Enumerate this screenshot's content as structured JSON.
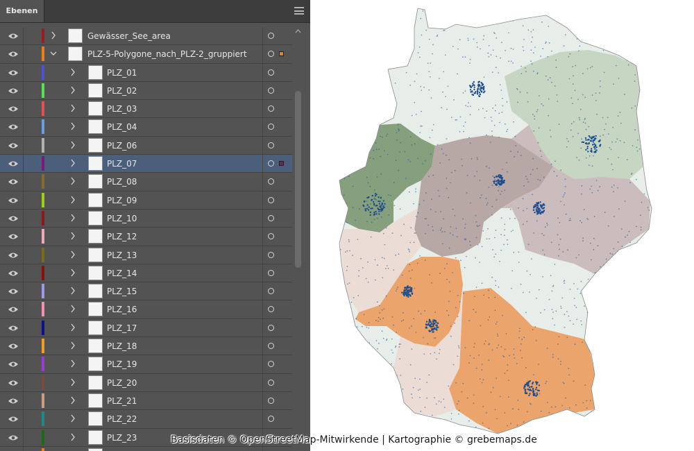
{
  "panel": {
    "tab_label": "Ebenen"
  },
  "layers": [
    {
      "name": "Gewässer_See_area",
      "color": "#9b1c1c",
      "level": 0,
      "expanded": false,
      "selected": false,
      "marker": ""
    },
    {
      "name": "PLZ-5-Polygone_nach_PLZ-2_gruppiert",
      "color": "#ef7c1b",
      "level": 0,
      "expanded": true,
      "selected": false,
      "marker": "#ef7c1b"
    },
    {
      "name": "PLZ_01",
      "color": "#4f4fd8",
      "level": 1,
      "expanded": false,
      "selected": false,
      "marker": ""
    },
    {
      "name": "PLZ_02",
      "color": "#58e058",
      "level": 1,
      "expanded": false,
      "selected": false,
      "marker": ""
    },
    {
      "name": "PLZ_03",
      "color": "#e55050",
      "level": 1,
      "expanded": false,
      "selected": false,
      "marker": ""
    },
    {
      "name": "PLZ_04",
      "color": "#6a9ee0",
      "level": 1,
      "expanded": false,
      "selected": false,
      "marker": ""
    },
    {
      "name": "PLZ_06",
      "color": "#b0b0b0",
      "level": 1,
      "expanded": false,
      "selected": false,
      "marker": ""
    },
    {
      "name": "PLZ_07",
      "color": "#7a1a7a",
      "level": 1,
      "expanded": false,
      "selected": true,
      "marker": "#7a1a7a"
    },
    {
      "name": "PLZ_08",
      "color": "#8a6a2a",
      "level": 1,
      "expanded": false,
      "selected": false,
      "marker": ""
    },
    {
      "name": "PLZ_09",
      "color": "#9ad21a",
      "level": 1,
      "expanded": false,
      "selected": false,
      "marker": ""
    },
    {
      "name": "PLZ_10",
      "color": "#8a1a1a",
      "level": 1,
      "expanded": false,
      "selected": false,
      "marker": ""
    },
    {
      "name": "PLZ_12",
      "color": "#f0a8b8",
      "level": 1,
      "expanded": false,
      "selected": false,
      "marker": ""
    },
    {
      "name": "PLZ_13",
      "color": "#7a6a1a",
      "level": 1,
      "expanded": false,
      "selected": false,
      "marker": ""
    },
    {
      "name": "PLZ_14",
      "color": "#8a1010",
      "level": 1,
      "expanded": false,
      "selected": false,
      "marker": ""
    },
    {
      "name": "PLZ_15",
      "color": "#9a9ae8",
      "level": 1,
      "expanded": false,
      "selected": false,
      "marker": ""
    },
    {
      "name": "PLZ_16",
      "color": "#f090b0",
      "level": 1,
      "expanded": false,
      "selected": false,
      "marker": ""
    },
    {
      "name": "PLZ_17",
      "color": "#10108a",
      "level": 1,
      "expanded": false,
      "selected": false,
      "marker": ""
    },
    {
      "name": "PLZ_18",
      "color": "#f0a020",
      "level": 1,
      "expanded": false,
      "selected": false,
      "marker": ""
    },
    {
      "name": "PLZ_19",
      "color": "#9a3ad8",
      "level": 1,
      "expanded": false,
      "selected": false,
      "marker": ""
    },
    {
      "name": "PLZ_20",
      "color": "#7a4a3a",
      "level": 1,
      "expanded": false,
      "selected": false,
      "marker": ""
    },
    {
      "name": "PLZ_21",
      "color": "#d09a80",
      "level": 1,
      "expanded": false,
      "selected": false,
      "marker": ""
    },
    {
      "name": "PLZ_22",
      "color": "#1a8a8a",
      "level": 1,
      "expanded": false,
      "selected": false,
      "marker": ""
    },
    {
      "name": "PLZ_23",
      "color": "#1a6a1a",
      "level": 1,
      "expanded": false,
      "selected": false,
      "marker": ""
    },
    {
      "name": "",
      "color": "#ef7c1b",
      "level": 1,
      "expanded": false,
      "selected": false,
      "marker": ""
    }
  ],
  "map": {
    "region_colors": {
      "north": "#e7eeea",
      "northeast": "#c7d6c3",
      "west": "#86a07e",
      "center": "#b7a8a6",
      "east": "#cbbcbd",
      "southwest_light": "#ecdcd6",
      "orange": "#eba56c",
      "dots": "#1f4e8c"
    }
  },
  "credit": "Basisdaten © OpenStreetMap-Mitwirkende | Kartographie © grebemaps.de"
}
